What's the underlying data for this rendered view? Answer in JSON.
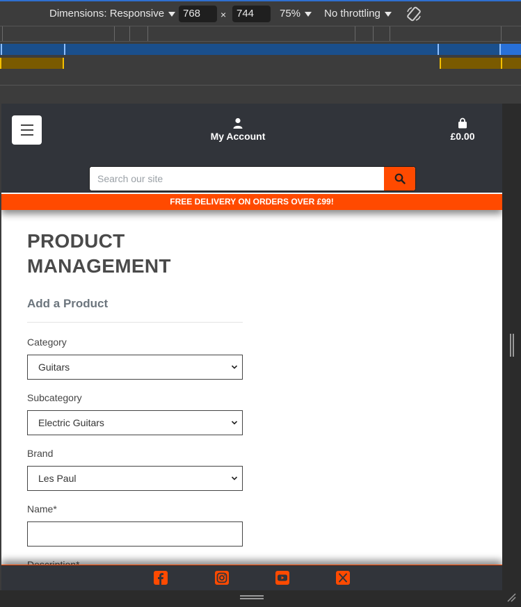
{
  "devtools": {
    "dimensions_label": "Dimensions: Responsive",
    "width_value": "768",
    "times": "×",
    "height_value": "744",
    "zoom": "75%",
    "throttling": "No throttling",
    "rotate_icon": "rotate-icon"
  },
  "header": {
    "menu_icon": "hamburger-icon",
    "account_label": "My Account",
    "account_icon": "user-icon",
    "cart_total": "£0.00",
    "cart_icon": "shopping-bag-icon",
    "search_placeholder": "Search our site",
    "search_icon": "search-icon",
    "banner": "FREE DELIVERY ON ORDERS OVER £99!"
  },
  "main": {
    "title_line1": "PRODUCT",
    "title_line2": "MANAGEMENT",
    "subtitle": "Add a Product",
    "fields": {
      "category_label": "Category",
      "category_value": "Guitars",
      "subcategory_label": "Subcategory",
      "subcategory_value": "Electric Guitars",
      "brand_label": "Brand",
      "brand_value": "Les Paul",
      "name_label": "Name*",
      "description_label": "Description*"
    }
  },
  "footer": {
    "social": [
      "facebook-icon",
      "instagram-icon",
      "youtube-icon",
      "x-icon"
    ]
  },
  "colors": {
    "accent": "#ff4a00",
    "header_bg": "#31343a",
    "devtools_bg": "#3c3c3c"
  }
}
